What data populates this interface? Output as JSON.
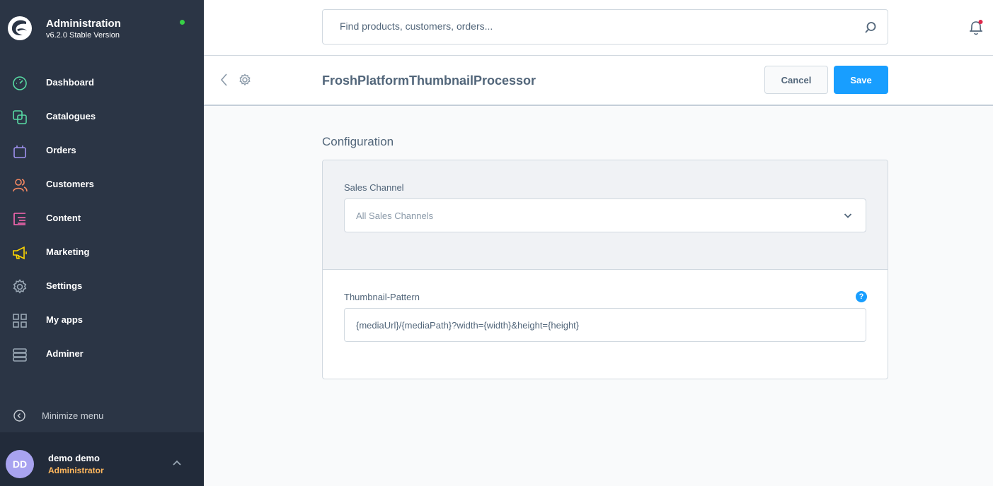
{
  "brand": {
    "title": "Administration",
    "version": "v6.2.0 Stable Version",
    "status_color": "#37d046"
  },
  "sidebar": {
    "items": [
      {
        "label": "Dashboard",
        "icon": "dashboard-gauge-icon",
        "color": "#57d9a3"
      },
      {
        "label": "Catalogues",
        "icon": "catalogues-icon",
        "color": "#57d9a3"
      },
      {
        "label": "Orders",
        "icon": "orders-bag-icon",
        "color": "#a092f0"
      },
      {
        "label": "Customers",
        "icon": "customers-icon",
        "color": "#f88962"
      },
      {
        "label": "Content",
        "icon": "content-icon",
        "color": "#ff68b4"
      },
      {
        "label": "Marketing",
        "icon": "marketing-megaphone-icon",
        "color": "#ffd700"
      },
      {
        "label": "Settings",
        "icon": "settings-gear-icon",
        "color": "#9aa8b5"
      },
      {
        "label": "My apps",
        "icon": "my-apps-grid-icon",
        "color": "#9aa8b5"
      },
      {
        "label": "Adminer",
        "icon": "adminer-database-icon",
        "color": "#9aa8b5"
      }
    ],
    "minimize_label": "Minimize menu"
  },
  "user": {
    "initials": "DD",
    "name": "demo demo",
    "role": "Administrator"
  },
  "search": {
    "placeholder": "Find products, customers, orders..."
  },
  "smartbar": {
    "title": "FroshPlatformThumbnailProcessor",
    "cancel_label": "Cancel",
    "save_label": "Save"
  },
  "config": {
    "section_title": "Configuration",
    "sales_channel_label": "Sales Channel",
    "sales_channel_value": "All Sales Channels",
    "thumbnail_pattern_label": "Thumbnail-Pattern",
    "thumbnail_pattern_value": "{mediaUrl}/{mediaPath}?width={width}&height={height}",
    "help_glyph": "?"
  }
}
